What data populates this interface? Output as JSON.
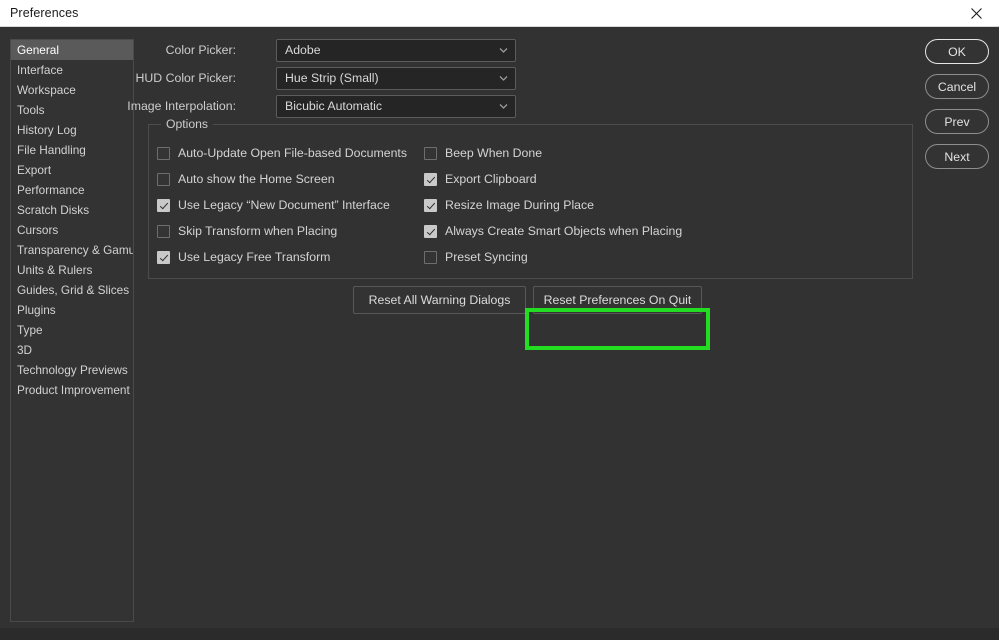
{
  "window": {
    "title": "Preferences",
    "close_icon": "close-icon"
  },
  "sidebar": {
    "selected": "General",
    "items": [
      {
        "label": "General"
      },
      {
        "label": "Interface"
      },
      {
        "label": "Workspace"
      },
      {
        "label": "Tools"
      },
      {
        "label": "History Log"
      },
      {
        "label": "File Handling"
      },
      {
        "label": "Export"
      },
      {
        "label": "Performance"
      },
      {
        "label": "Scratch Disks"
      },
      {
        "label": "Cursors"
      },
      {
        "label": "Transparency & Gamut"
      },
      {
        "label": "Units & Rulers"
      },
      {
        "label": "Guides, Grid & Slices"
      },
      {
        "label": "Plugins"
      },
      {
        "label": "Type"
      },
      {
        "label": "3D"
      },
      {
        "label": "Technology Previews"
      },
      {
        "label": "Product Improvement"
      }
    ]
  },
  "fields": [
    {
      "label": "Color Picker:",
      "value": "Adobe",
      "arrow_icon": "chevron-down-icon"
    },
    {
      "label": "HUD Color Picker:",
      "value": "Hue Strip (Small)",
      "arrow_icon": "chevron-down-icon"
    },
    {
      "label": "Image Interpolation:",
      "value": "Bicubic Automatic",
      "arrow_icon": "chevron-down-icon"
    }
  ],
  "options": {
    "legend": "Options",
    "left_column": [
      {
        "label": "Auto-Update Open File-based Documents",
        "checked": false
      },
      {
        "label": "Auto show the Home Screen",
        "checked": false
      },
      {
        "label": "Use Legacy “New Document” Interface",
        "checked": true
      },
      {
        "label": "Skip Transform when Placing",
        "checked": false
      },
      {
        "label": "Use Legacy Free Transform",
        "checked": true
      }
    ],
    "right_column": [
      {
        "label": "Beep When Done",
        "checked": false
      },
      {
        "label": "Export Clipboard",
        "checked": true
      },
      {
        "label": "Resize Image During Place",
        "checked": true
      },
      {
        "label": "Always Create Smart Objects when Placing",
        "checked": true
      },
      {
        "label": "Preset Syncing",
        "checked": false
      }
    ]
  },
  "reset_buttons": [
    {
      "label": "Reset All Warning Dialogs",
      "highlighted": false
    },
    {
      "label": "Reset Preferences On Quit",
      "highlighted": true
    }
  ],
  "action_buttons": [
    {
      "label": "OK",
      "primary": true
    },
    {
      "label": "Cancel",
      "primary": false
    },
    {
      "label": "Prev",
      "primary": false
    },
    {
      "label": "Next",
      "primary": false
    }
  ],
  "colors": {
    "highlight": "#22dd22",
    "dialog_background": "#323232",
    "titlebar_background": "#ffffff",
    "selection": "#5a5a5a"
  }
}
